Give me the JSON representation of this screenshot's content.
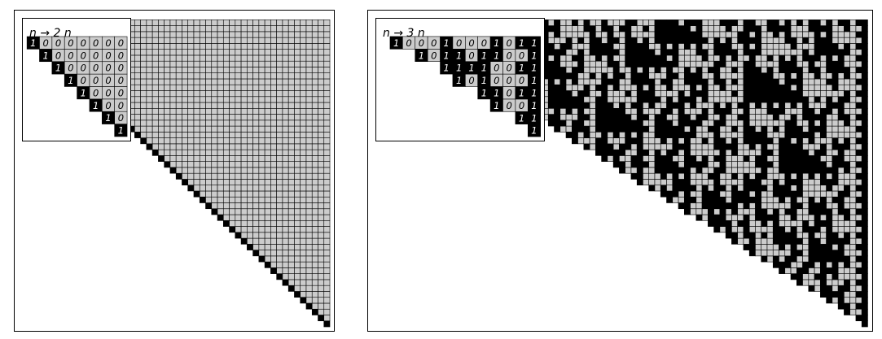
{
  "colors": {
    "black": "#000000",
    "light": "#cccccc",
    "grid_line": "#000000",
    "zero_text": "#000000",
    "one_text": "#ffffff"
  },
  "panels": [
    {
      "id": "doubling",
      "label": "n → 2 n",
      "multiplier": 2,
      "steps": 7
    },
    {
      "id": "tripling",
      "label": "n → 3 n",
      "multiplier": 3,
      "steps": 7
    }
  ]
}
